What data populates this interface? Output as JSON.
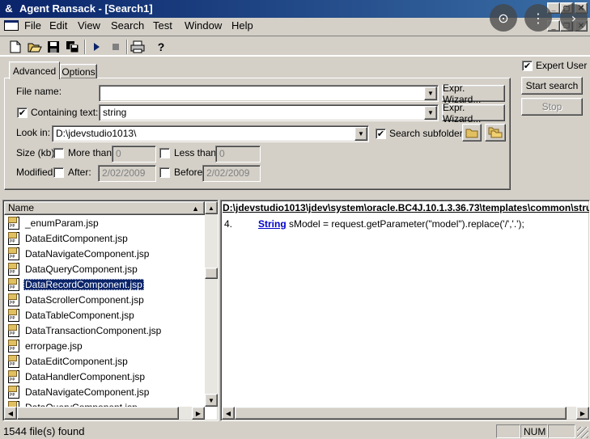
{
  "window": {
    "title": "Agent Ransack - [Search1]"
  },
  "menu": [
    "File",
    "Edit",
    "View",
    "Search",
    "Test",
    "Window",
    "Help"
  ],
  "toolbar": {
    "icons": [
      "new-icon",
      "open-icon",
      "save-icon",
      "save-all-icon",
      "start-icon",
      "stop-icon",
      "print-icon",
      "help-icon"
    ]
  },
  "tabs": {
    "advanced": "Advanced",
    "options": "Options"
  },
  "form": {
    "file_name_label": "File name:",
    "file_name_value": "",
    "containing_text_label": "Containing text:",
    "containing_text_value": "string",
    "containing_text_checked": "✔",
    "expr_wizard": "Expr. Wizard...",
    "look_in_label": "Look in:",
    "look_in_value": "D:\\jdevstudio1013\\",
    "search_subfolders_label": "Search subfolders",
    "search_subfolders_checked": "✔",
    "size_label": "Size (kb):",
    "more_than_label": "More than:",
    "more_than_value": "0",
    "less_than_label": "Less than:",
    "less_than_value": "0",
    "modified_label": "Modified:",
    "after_label": "After:",
    "after_value": "2/02/2009",
    "before_label": "Before:",
    "before_value": "2/02/2009"
  },
  "right_panel": {
    "expert_user_label": "Expert User",
    "expert_user_checked": "✔",
    "start_search": "Start search",
    "stop": "Stop"
  },
  "results": {
    "column_header": "Name",
    "files": [
      "_enumParam.jsp",
      "DataEditComponent.jsp",
      "DataNavigateComponent.jsp",
      "DataQueryComponent.jsp",
      "DataRecordComponent.jsp",
      "DataScrollerComponent.jsp",
      "DataTableComponent.jsp",
      "DataTransactionComponent.jsp",
      "errorpage.jsp",
      "DataEditComponent.jsp",
      "DataHandlerComponent.jsp",
      "DataNavigateComponent.jsp",
      "DataQueryComponent.jsp"
    ],
    "selected_index": 4
  },
  "preview": {
    "path": "D:\\jdevstudio1013\\jdev\\system\\oracle.BC4J.10.1.3.36.73\\templates\\common\\stru",
    "line_number": "4.",
    "keyword": "String",
    "code": " sModel = request.getParameter(\"model\").replace('/','.');"
  },
  "status": {
    "files_found": "1544 file(s) found",
    "num": "NUM"
  },
  "colors": {
    "face": "#d4d0c8",
    "title_start": "#0a246a",
    "title_end": "#3a6ea5",
    "selection": "#0a246a",
    "keyword": "#0000cc"
  }
}
